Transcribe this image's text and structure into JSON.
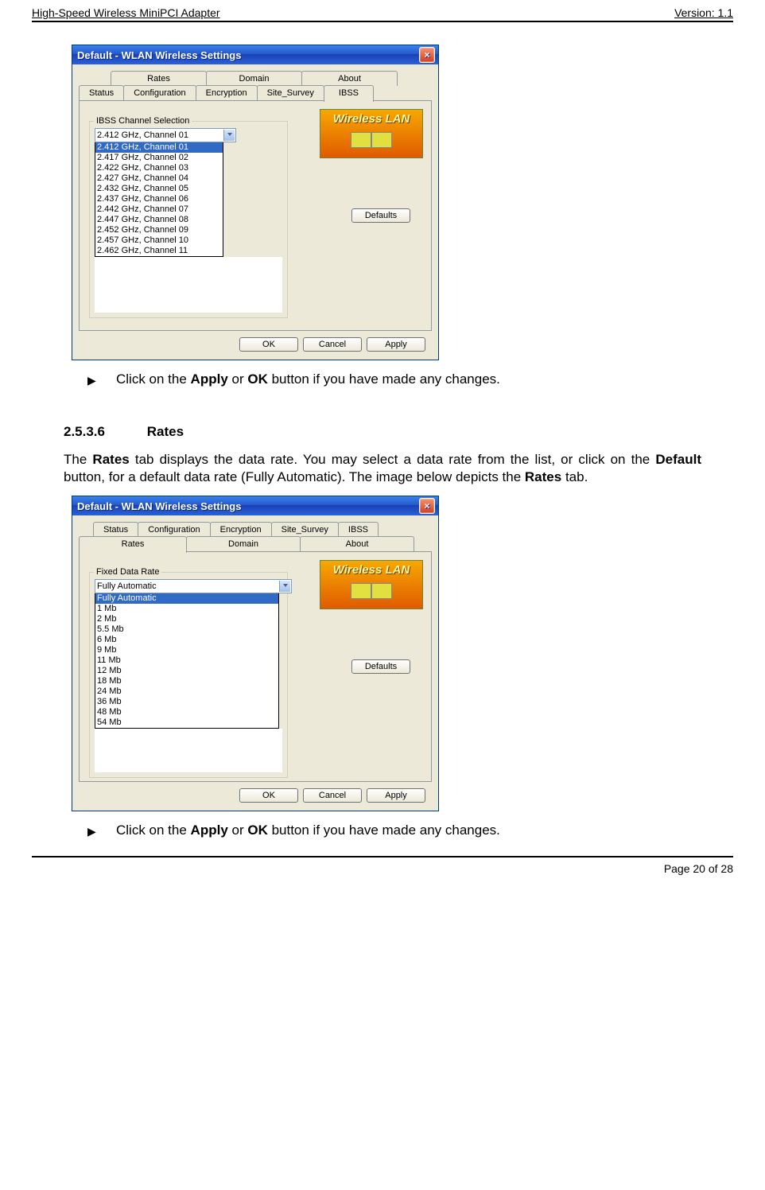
{
  "header": {
    "left": "High-Speed Wireless MiniPCI Adapter",
    "right": "Version: 1.1"
  },
  "footer": {
    "text": "Page 20 of 28"
  },
  "window_common": {
    "title": "Default - WLAN Wireless Settings",
    "logo_title": "Wireless LAN",
    "defaults_btn": "Defaults",
    "ok_btn": "OK",
    "cancel_btn": "Cancel",
    "apply_btn": "Apply",
    "close_glyph": "×"
  },
  "win1": {
    "tabs_back": [
      "Rates",
      "Domain",
      "About"
    ],
    "tabs_front": [
      "Status",
      "Configuration",
      "Encryption",
      "Site_Survey"
    ],
    "tab_active": "IBSS",
    "group_label": "IBSS Channel Selection",
    "combo_value": "2.412 GHz, Channel 01",
    "list": [
      "2.412 GHz, Channel 01",
      "2.417 GHz, Channel 02",
      "2.422 GHz, Channel 03",
      "2.427 GHz, Channel 04",
      "2.432 GHz, Channel 05",
      "2.437 GHz, Channel 06",
      "2.442 GHz, Channel 07",
      "2.447 GHz, Channel 08",
      "2.452 GHz, Channel 09",
      "2.457 GHz, Channel 10",
      "2.462 GHz, Channel 11"
    ],
    "list_selected_index": 0
  },
  "text": {
    "bullet1_pre": "Click on the ",
    "bullet1_b1": "Apply",
    "bullet1_mid": " or ",
    "bullet1_b2": "OK",
    "bullet1_post": " button if you have made any changes.",
    "section_num": "2.5.3.6",
    "section_title": "Rates",
    "para_pre": "The ",
    "para_b1": "Rates",
    "para_mid1": " tab displays the data rate.  You may select a data rate from the list, or click on the ",
    "para_b2": "Default",
    "para_mid2": " button, for a default data rate (Fully Automatic). The image below depicts the ",
    "para_b3": "Rates",
    "para_post": " tab.",
    "bullet2_pre": "Click on the ",
    "bullet2_b1": "Apply",
    "bullet2_mid": " or ",
    "bullet2_b2": "OK",
    "bullet2_post": " button if you have made any changes."
  },
  "win2": {
    "tabs_back": [
      "Status",
      "Configuration",
      "Encryption",
      "Site_Survey",
      "IBSS"
    ],
    "tabs_front_active": "Rates",
    "tabs_front_rest": [
      "Domain",
      "About"
    ],
    "group_label": "Fixed Data Rate",
    "combo_value": "Fully Automatic",
    "list": [
      "Fully Automatic",
      "1 Mb",
      "2 Mb",
      "5.5 Mb",
      "6 Mb",
      "9 Mb",
      "11 Mb",
      "12 Mb",
      "18 Mb",
      "24 Mb",
      "36 Mb",
      "48 Mb",
      "54 Mb"
    ],
    "list_selected_index": 0
  }
}
